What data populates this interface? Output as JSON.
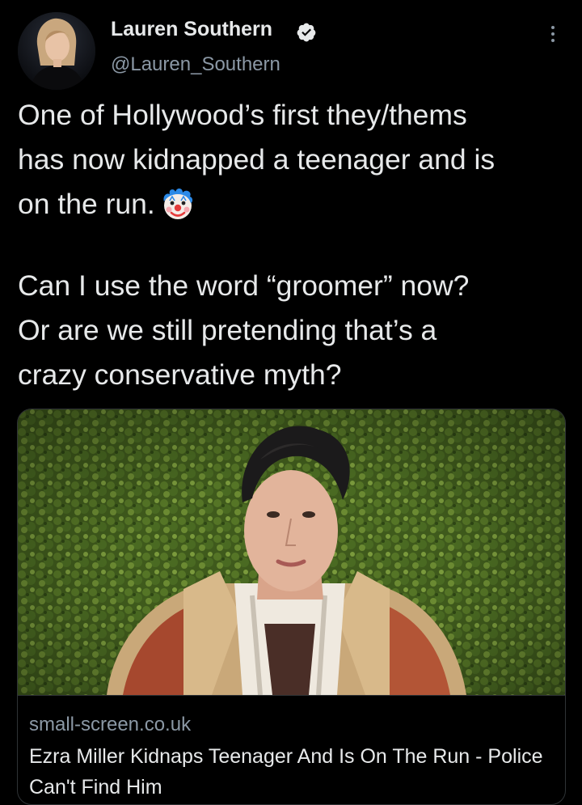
{
  "author": {
    "display_name": "Lauren Southern",
    "handle": "@Lauren_Southern",
    "verified": true,
    "avatar_icon": "profile-photo"
  },
  "tweet": {
    "lines": [
      "One of Hollywood’s first they/thems",
      "has now kidnapped a teenager and is",
      "on the run.",
      "Can I use the word “groomer” now?",
      "Or are we still pretending that’s a",
      "crazy conservative myth?"
    ],
    "emoji": "clown-face-emoji"
  },
  "link_card": {
    "domain": "small-screen.co.uk",
    "title": "Ezra Miller Kidnaps Teenager And Is On The Run - Police Can't Find Him",
    "image_icon": "article-photo"
  },
  "colors": {
    "background": "#000000",
    "text": "#e7e9ea",
    "secondary_text": "#8b98a5",
    "border": "#2f3336"
  }
}
